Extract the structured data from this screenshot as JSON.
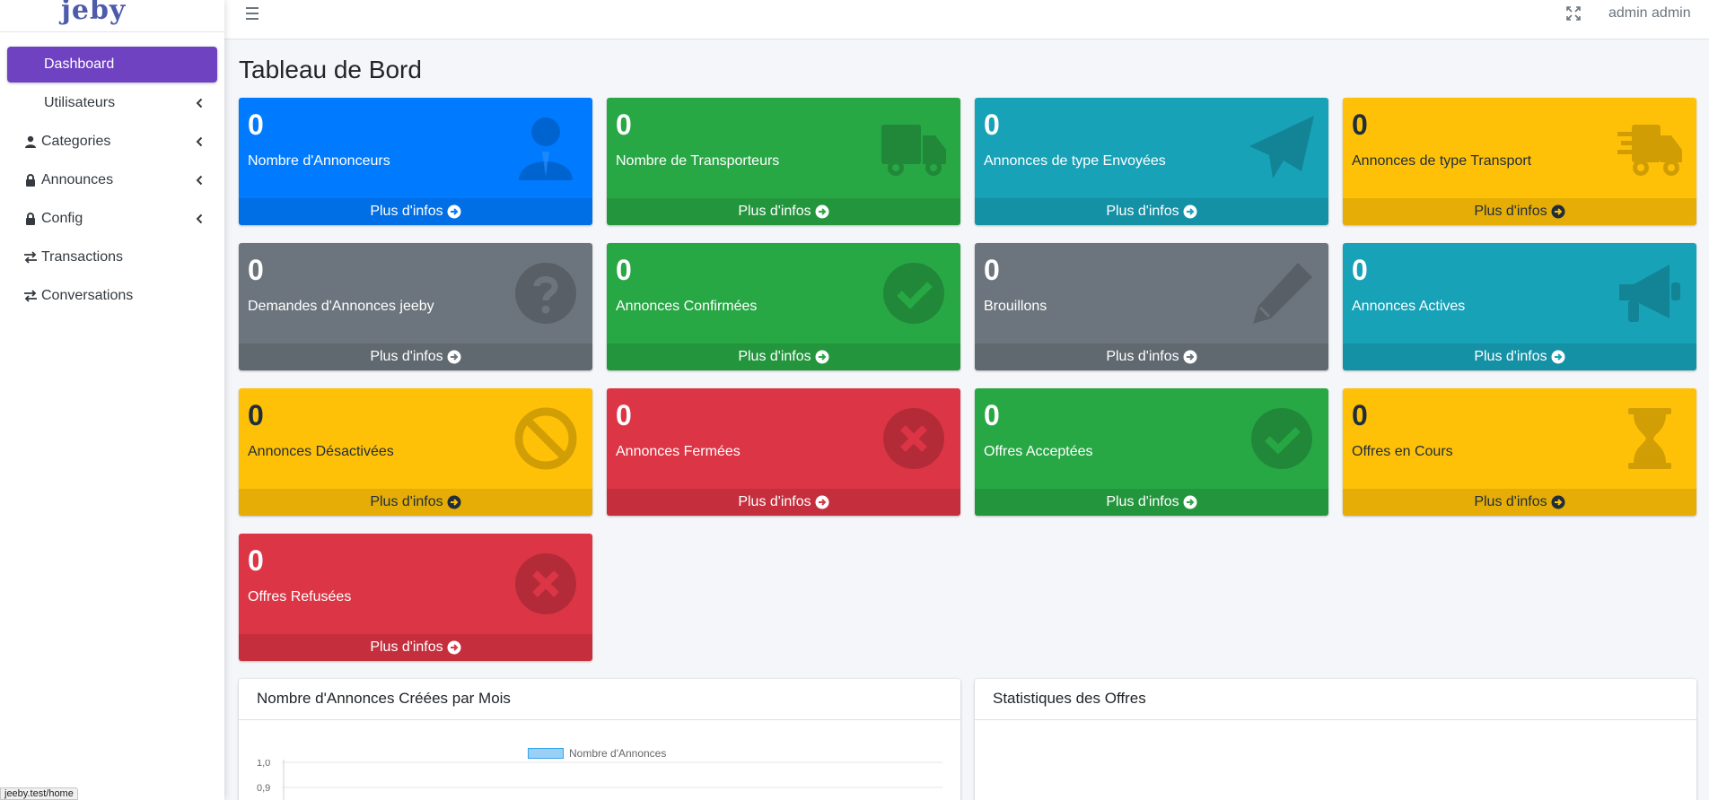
{
  "brand": {
    "logo_text": "jeby"
  },
  "sidebar": {
    "items": [
      {
        "label": "Dashboard",
        "icon": "none",
        "active": true,
        "has_chevron": false
      },
      {
        "label": "Utilisateurs",
        "icon": "none",
        "active": false,
        "has_chevron": true
      },
      {
        "label": "Categories",
        "icon": "user-icon",
        "active": false,
        "has_chevron": true
      },
      {
        "label": "Announces",
        "icon": "lock-icon",
        "active": false,
        "has_chevron": true
      },
      {
        "label": "Config",
        "icon": "lock-icon",
        "active": false,
        "has_chevron": true
      },
      {
        "label": "Transactions",
        "icon": "exchange-icon",
        "active": false,
        "has_chevron": false
      },
      {
        "label": "Conversations",
        "icon": "exchange-icon",
        "active": false,
        "has_chevron": false
      }
    ]
  },
  "topbar": {
    "user_name": "admin admin"
  },
  "page": {
    "title": "Tableau de Bord"
  },
  "boxes": [
    {
      "count": "0",
      "title": "Nombre d'Annonceurs",
      "link": "Plus d'infos",
      "color": "#007bff",
      "icon": "user-tie-icon"
    },
    {
      "count": "0",
      "title": "Nombre de Transporteurs",
      "link": "Plus d'infos",
      "color": "#28a745",
      "icon": "truck-icon"
    },
    {
      "count": "0",
      "title": "Annonces de type Envoyées",
      "link": "Plus d'infos",
      "color": "#17a2b8",
      "icon": "paper-plane-icon"
    },
    {
      "count": "0",
      "title": "Annonces de type Transport",
      "link": "Plus d'infos",
      "color": "#ffc107",
      "icon": "shipping-fast-icon"
    },
    {
      "count": "0",
      "title": "Demandes d'Annonces jeeby",
      "link": "Plus d'infos",
      "color": "#6c757d",
      "icon": "question-circle-icon"
    },
    {
      "count": "0",
      "title": "Annonces Confirmées",
      "link": "Plus d'infos",
      "color": "#28a745",
      "icon": "check-circle-icon"
    },
    {
      "count": "0",
      "title": "Brouillons",
      "link": "Plus d'infos",
      "color": "#6c757d",
      "icon": "pencil-icon"
    },
    {
      "count": "0",
      "title": "Annonces Actives",
      "link": "Plus d'infos",
      "color": "#17a2b8",
      "icon": "bullhorn-icon"
    },
    {
      "count": "0",
      "title": "Annonces Désactivées",
      "link": "Plus d'infos",
      "color": "#ffc107",
      "icon": "ban-icon"
    },
    {
      "count": "0",
      "title": "Annonces Fermées",
      "link": "Plus d'infos",
      "color": "#dc3545",
      "icon": "times-circle-icon"
    },
    {
      "count": "0",
      "title": "Offres Acceptées",
      "link": "Plus d'infos",
      "color": "#28a745",
      "icon": "check-circle-icon"
    },
    {
      "count": "0",
      "title": "Offres en Cours",
      "link": "Plus d'infos",
      "color": "#ffc107",
      "icon": "hourglass-icon"
    },
    {
      "count": "0",
      "title": "Offres Refusées",
      "link": "Plus d'infos",
      "color": "#dc3545",
      "icon": "times-circle-icon"
    }
  ],
  "cards": {
    "monthly": {
      "title": "Nombre d'Annonces Créées par Mois",
      "legend": "Nombre d'Annonces",
      "ticks": [
        "1,0",
        "0,9"
      ]
    },
    "offers": {
      "title": "Statistiques des Offres"
    }
  },
  "statusbar": {
    "url": "jeeby.test/home"
  }
}
